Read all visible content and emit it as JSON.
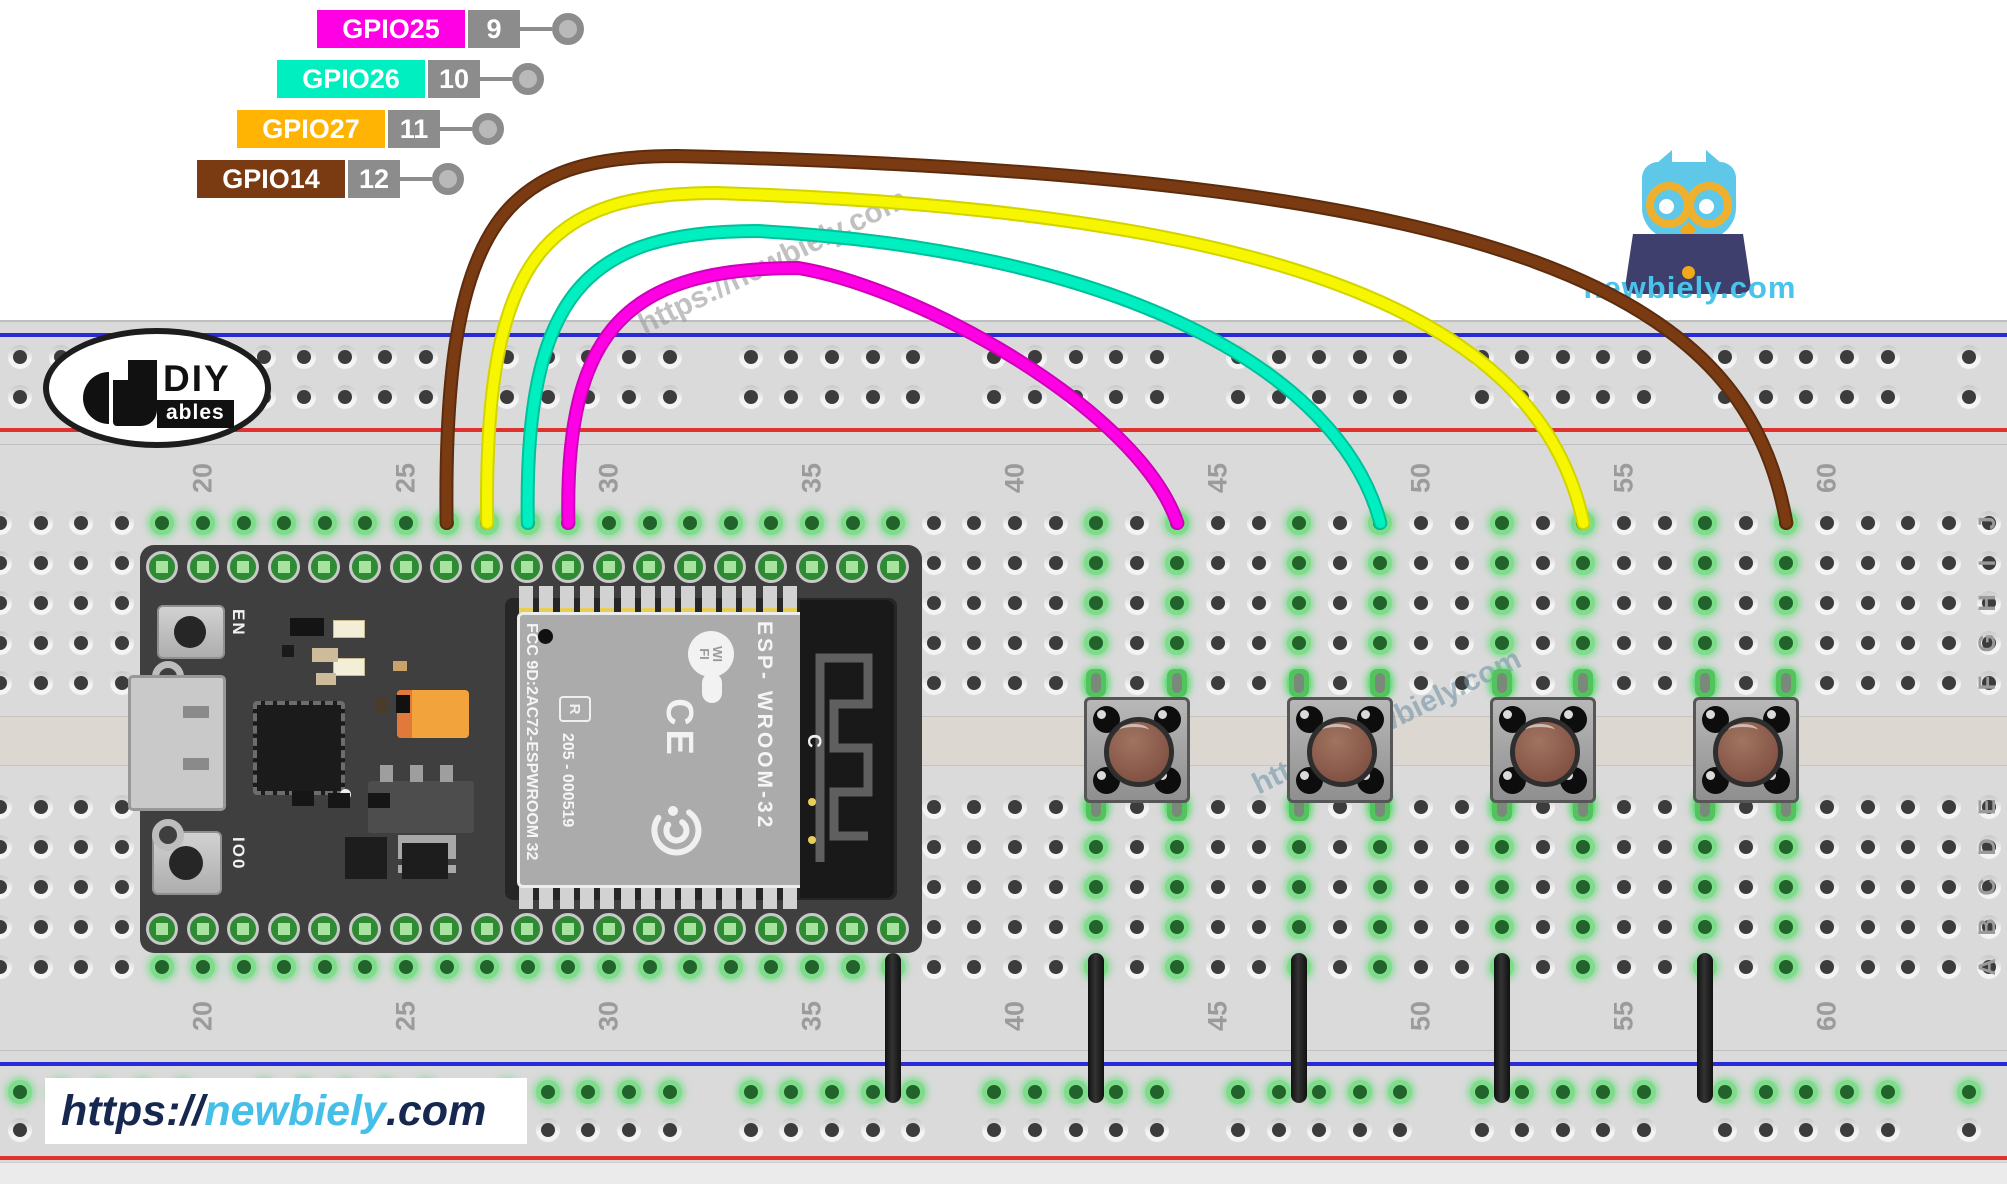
{
  "header_labels": [
    {
      "gpio": "GPIO25",
      "pin": "9",
      "color": "#ff00e4"
    },
    {
      "gpio": "GPIO26",
      "pin": "10",
      "color": "#00efc1"
    },
    {
      "gpio": "GPIO27",
      "pin": "11",
      "color": "#ffb404"
    },
    {
      "gpio": "GPIO14",
      "pin": "12",
      "color": "#7a3b12"
    }
  ],
  "diyables_logo": {
    "title": "DIY",
    "subtitle": "ables"
  },
  "newbiely_logo": {
    "site": "newbiely.com"
  },
  "watermark_text": "https://newbiely.com",
  "footer_url": {
    "protocol": "https://",
    "name": "newbiely",
    "tld": ".com"
  },
  "breadboard": {
    "column_numbers": [
      "20",
      "25",
      "30",
      "35",
      "40",
      "45",
      "50",
      "55",
      "60"
    ],
    "row_letters_top": [
      "J",
      "I",
      "H",
      "G",
      "F"
    ],
    "row_letters_bottom": [
      "E",
      "D",
      "C",
      "B",
      "A"
    ],
    "rail_negative_color": "#2a2ad6",
    "rail_positive_color": "#e03131"
  },
  "esp32_board": {
    "en_label": "EN",
    "io0_label": "IO0",
    "module_fcc": "FCC 9D:2AC72-ESPWROOM 32",
    "module_serial": "205 - 000519",
    "module_r_mark": "R",
    "module_wifi_line1": "WI",
    "module_wifi_line2": "FI",
    "module_ce": "CE",
    "module_name": "ESP- WROOM-32",
    "antenna_label": "C"
  },
  "wires": [
    {
      "name": "magenta",
      "gpio": "GPIO25",
      "color": "#ff00e4",
      "outline": "#cf00b9",
      "from_col": 29,
      "to_col": 44,
      "apex": 268
    },
    {
      "name": "cyan",
      "gpio": "GPIO26",
      "color": "#00efc1",
      "outline": "#00c09b",
      "from_col": 28,
      "to_col": 49,
      "apex": 231
    },
    {
      "name": "yellow",
      "gpio": "GPIO27",
      "color": "#f6f600",
      "outline": "#d3d300",
      "from_col": 27,
      "to_col": 54,
      "apex": 193
    },
    {
      "name": "brown",
      "gpio": "GPIO14",
      "color": "#7a3b12",
      "outline": "#5d2c0c",
      "from_col": 26,
      "to_col": 59,
      "apex": 156
    }
  ],
  "ground_wires": {
    "color": "#1f1f1f",
    "columns": [
      37,
      42,
      47,
      52,
      57
    ]
  },
  "push_buttons": {
    "cap_color": "#8b5b4b",
    "body_color": "#a2a2a2",
    "positions_cols": [
      [
        42,
        44
      ],
      [
        47,
        49
      ],
      [
        52,
        54
      ],
      [
        57,
        59
      ]
    ]
  }
}
